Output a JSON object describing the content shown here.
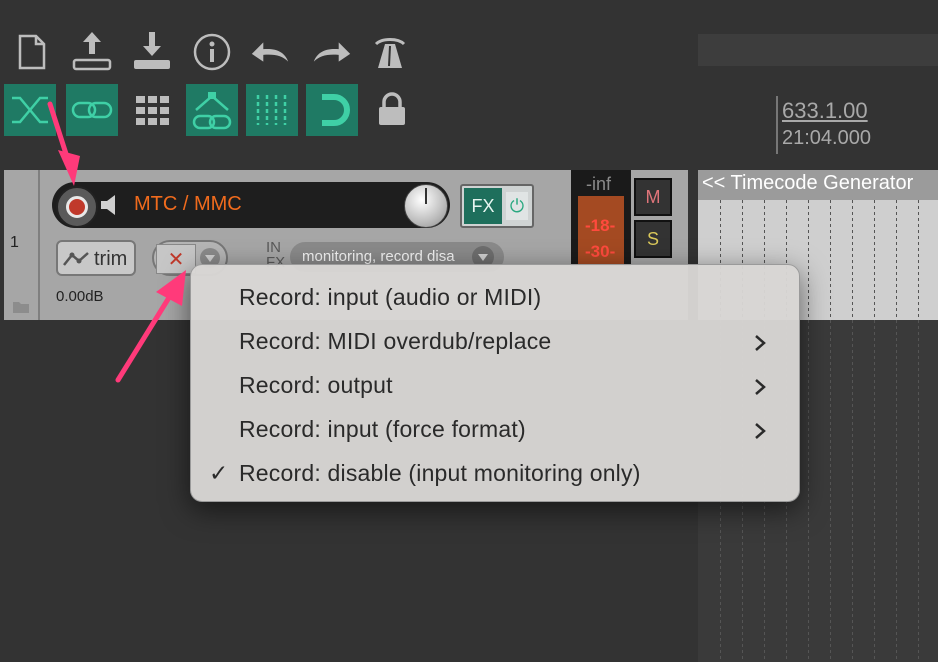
{
  "toolbar": {
    "row1": [
      {
        "name": "new-project-icon"
      },
      {
        "name": "save-project-icon"
      },
      {
        "name": "open-project-icon"
      },
      {
        "name": "project-info-icon"
      },
      {
        "name": "undo-icon"
      },
      {
        "name": "redo-icon"
      },
      {
        "name": "metronome-icon"
      }
    ],
    "row2": [
      {
        "name": "auto-crossfade-icon",
        "state": "on"
      },
      {
        "name": "item-grouping-icon",
        "state": "on"
      },
      {
        "name": "snap-grid-icon",
        "state": "off"
      },
      {
        "name": "ripple-edit-icon",
        "state": "on"
      },
      {
        "name": "grid-lines-icon",
        "state": "on"
      },
      {
        "name": "snap-magnet-icon",
        "state": "on"
      },
      {
        "name": "lock-icon",
        "state": "off"
      }
    ]
  },
  "ruler": {
    "position_beats": "633.1.00",
    "position_time": "21:04.000"
  },
  "track": {
    "number": "1",
    "name": "MTC / MMC",
    "trim_label": "trim",
    "trim_value": "0.00dB",
    "fx_label": "FX",
    "in_label": "IN",
    "fx_sub_label": "FX",
    "input_status": "monitoring, record disa",
    "meter_peak": "-inf",
    "meter_value_1": "-18-",
    "meter_value_2": "-30-",
    "mute_label": "M",
    "solo_label": "S"
  },
  "item": {
    "label": "<< Timecode Generator"
  },
  "record_mode_menu": {
    "items": [
      {
        "label": "Record: input (audio or MIDI)",
        "checked": false,
        "submenu": false
      },
      {
        "label": "Record: MIDI overdub/replace",
        "checked": false,
        "submenu": true
      },
      {
        "label": "Record: output",
        "checked": false,
        "submenu": true
      },
      {
        "label": "Record: input (force format)",
        "checked": false,
        "submenu": true
      },
      {
        "label": "Record: disable (input monitoring only)",
        "checked": true,
        "submenu": false
      }
    ],
    "check_glyph": "✓"
  },
  "colors": {
    "background": "#333333",
    "accent_teal": "#1f7a64",
    "track_name_orange": "#f06b1d",
    "annotation_arrow": "#ff3a7a"
  }
}
